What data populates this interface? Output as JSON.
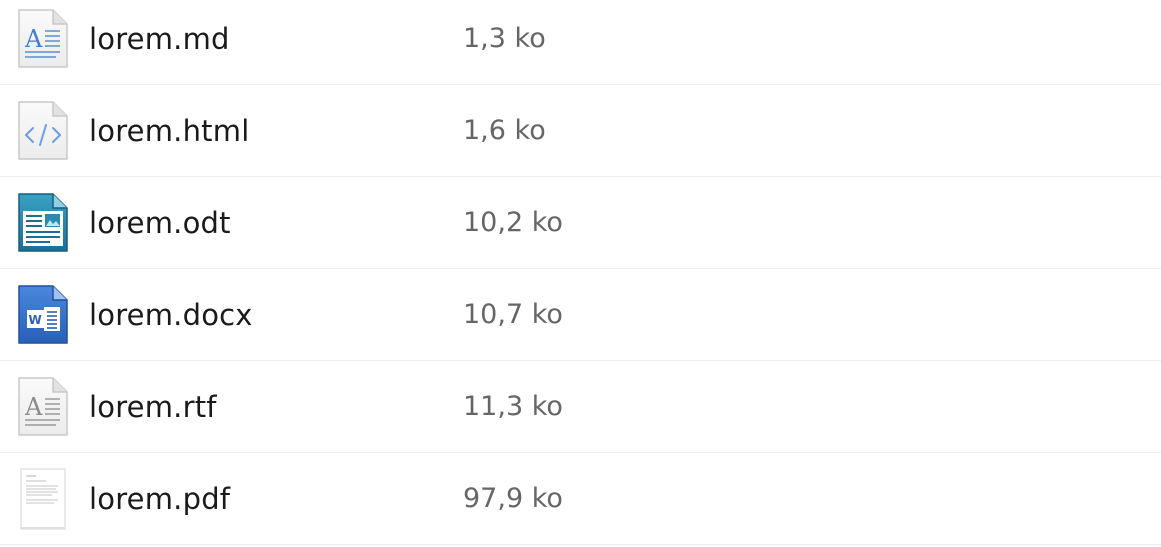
{
  "files": [
    {
      "name": "lorem.md",
      "size": "1,3 ko",
      "icon": "markdown-icon"
    },
    {
      "name": "lorem.html",
      "size": "1,6 ko",
      "icon": "html-code-icon"
    },
    {
      "name": "lorem.odt",
      "size": "10,2 ko",
      "icon": "odt-document-icon"
    },
    {
      "name": "lorem.docx",
      "size": "10,7 ko",
      "icon": "word-document-icon"
    },
    {
      "name": "lorem.rtf",
      "size": "11,3 ko",
      "icon": "rtf-text-icon"
    },
    {
      "name": "lorem.pdf",
      "size": "97,9 ko",
      "icon": "pdf-document-icon"
    }
  ]
}
